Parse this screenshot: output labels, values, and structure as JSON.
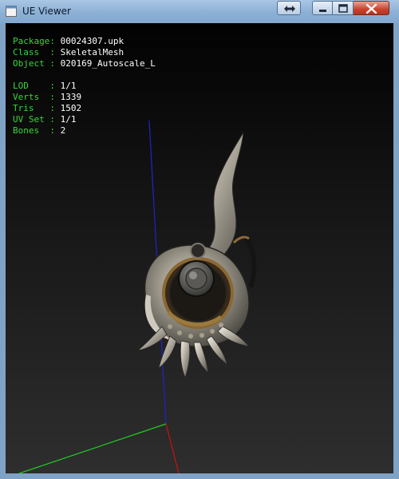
{
  "window": {
    "title": "UE Viewer"
  },
  "info": {
    "package_key": "Package:",
    "package_value": "00024307.upk",
    "class_key": "Class  :",
    "class_value": "SkeletalMesh",
    "object_key": "Object :",
    "object_value": "020169_Autoscale_L",
    "lod_key": "LOD    :",
    "lod_value": "1/1",
    "verts_key": "Verts  :",
    "verts_value": "1339",
    "tris_key": "Tris   :",
    "tris_value": "1502",
    "uvset_key": "UV Set :",
    "uvset_value": "1/1",
    "bones_key": "Bones  :",
    "bones_value": "2"
  },
  "colors": {
    "label": "#39d639",
    "value": "#ffffff",
    "axis_x": "#cc1111",
    "axis_y": "#22cc22",
    "axis_z": "#2222cc"
  }
}
